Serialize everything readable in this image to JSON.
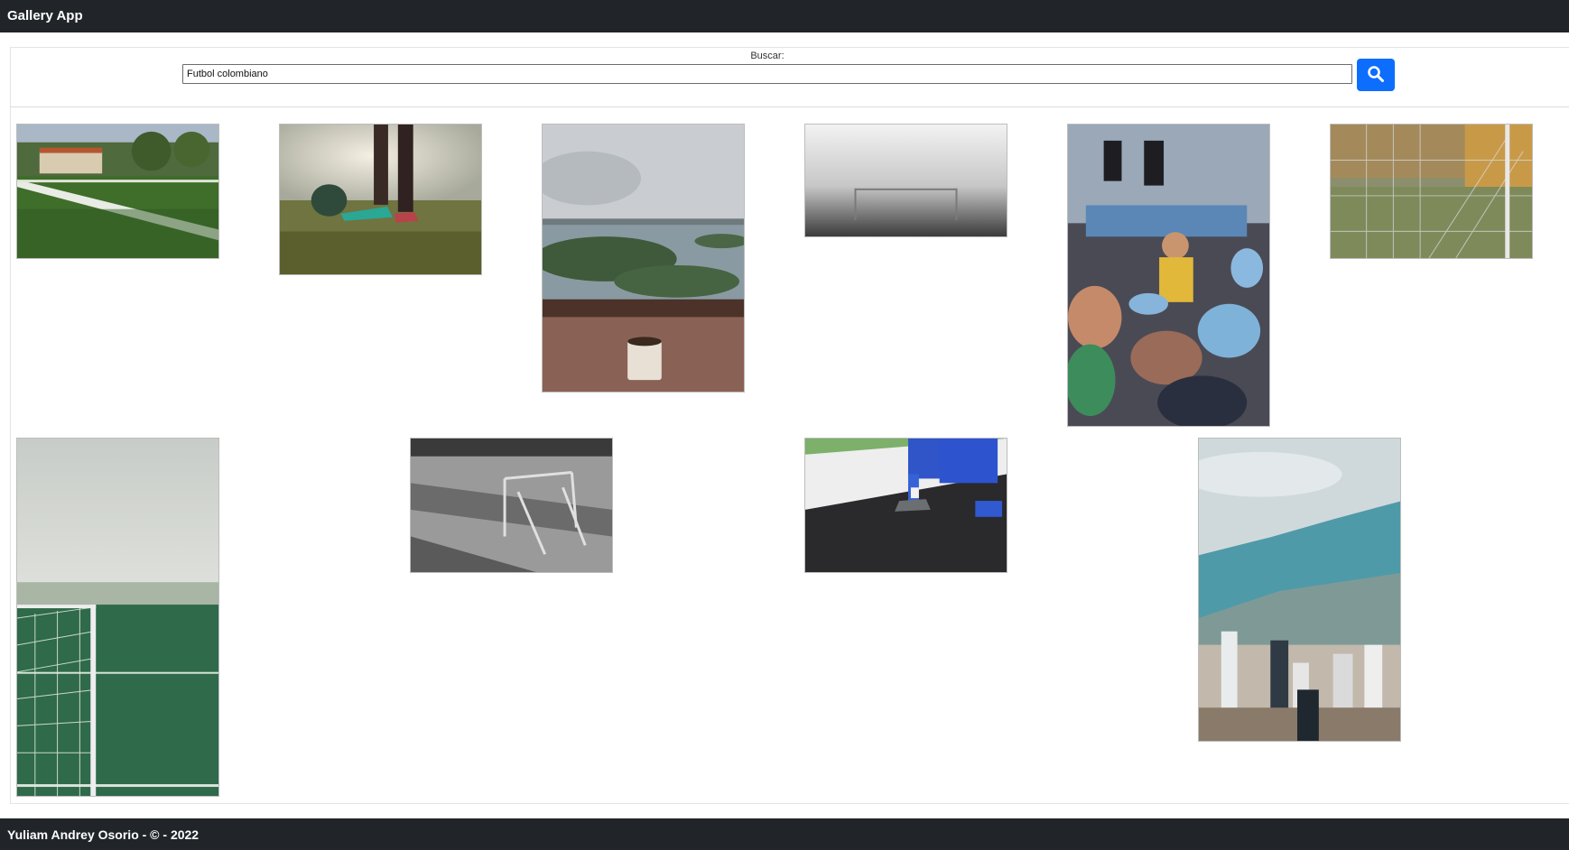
{
  "app": {
    "title": "Gallery App"
  },
  "search": {
    "label": "Buscar:",
    "value": "Futbol colombiano",
    "button_icon": "search-icon"
  },
  "gallery": {
    "photos": [
      {
        "subject": "field corner line"
      },
      {
        "subject": "player with ball"
      },
      {
        "subject": "lake view with cup"
      },
      {
        "subject": "goal in fog"
      },
      {
        "subject": "fans celebrating"
      },
      {
        "subject": "goal net"
      },
      {
        "subject": "goal net foggy field"
      },
      {
        "subject": "abandoned goal black and white"
      },
      {
        "subject": "kneeling player"
      },
      {
        "subject": "city hillside"
      }
    ]
  },
  "footer": {
    "text": "Yuliam Andrey Osorio - © - 2022"
  },
  "colors": {
    "navbar": "#212529",
    "accent": "#0d6efd"
  }
}
